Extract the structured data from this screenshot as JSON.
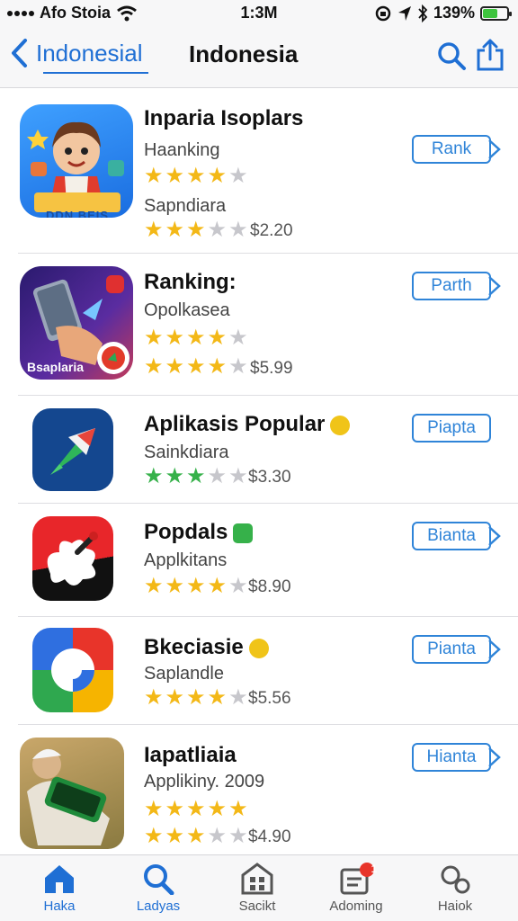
{
  "status_bar": {
    "carrier": "Afo Stoia",
    "time": "1:3M",
    "battery": "139%",
    "battery_level": 0.6
  },
  "nav": {
    "back_label": "Indonesial",
    "title": "Indonesia"
  },
  "apps": [
    {
      "name": "Inparia Isoplars",
      "line1": "Haanking",
      "line2": "Sapndiara",
      "rating1": 4,
      "rating2": 3,
      "price": "$2.20",
      "button": "Rank",
      "icon": "cartoon-boy-app-icon",
      "icon_text": "DDN BEIS"
    },
    {
      "name": "Ranking:",
      "line1": "Opolkasea",
      "line2": "",
      "rating1": 4,
      "rating2": 3.5,
      "price": "$5.99",
      "button": "Parth",
      "icon": "phone-hand-app-icon",
      "icon_text": "Bsaplaria"
    },
    {
      "name": "Aplikasis Popular",
      "line1": "Sainkdiara",
      "line2": "",
      "rating1": 3,
      "rating2": null,
      "price": "$3.30",
      "button": "Piapta",
      "icon": "arrow-app-icon",
      "badge_color": "#f0c419"
    },
    {
      "name": "Popdals",
      "line1": "Applkitans",
      "line2": "",
      "rating1": 4,
      "rating2": null,
      "price": "$8.90",
      "button": "Bianta",
      "icon": "splash-app-icon",
      "badge_color": "#36b14a"
    },
    {
      "name": "Bkeciasie",
      "line1": "Saplandle",
      "line2": "",
      "rating1": 3.5,
      "rating2": null,
      "price": "$5.56",
      "button": "Pianta",
      "icon": "colorful-ring-app-icon",
      "badge_color": "#f0c419"
    },
    {
      "name": "Iapatliaia",
      "line1": "Applikiny. 2009",
      "line2": "",
      "rating1": 5,
      "rating2": 3,
      "price": "$4.90",
      "button": "Hianta",
      "icon": "photo-phone-app-icon"
    }
  ],
  "tabs": [
    {
      "label": "Haka",
      "icon": "home-icon",
      "active": true
    },
    {
      "label": "Ladyas",
      "icon": "search-icon",
      "active": true
    },
    {
      "label": "Sacikt",
      "icon": "store-icon",
      "active": false
    },
    {
      "label": "Adoming",
      "icon": "updates-icon",
      "active": false,
      "badge": "1"
    },
    {
      "label": "Haiok",
      "icon": "profile-icon",
      "active": false
    }
  ],
  "colors": {
    "accent": "#1f6fd4",
    "star": "#f3b817",
    "star_green": "#36b14a"
  }
}
